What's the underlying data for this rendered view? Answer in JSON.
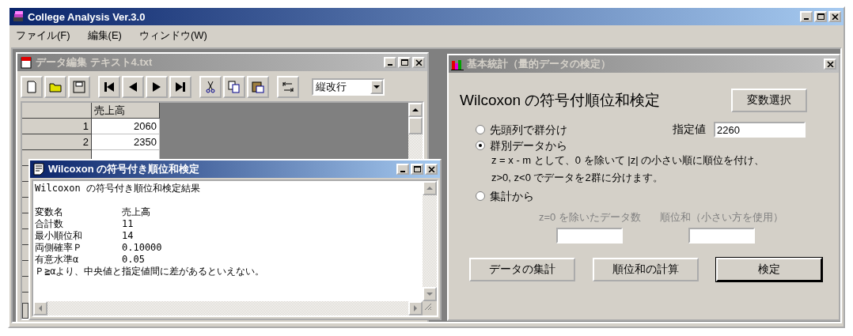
{
  "app": {
    "title": "College Analysis Ver.3.0",
    "active": true
  },
  "menu": [
    "ファイル(F)",
    "編集(E)",
    "ウィンドウ(W)"
  ],
  "data_window": {
    "title": "データ編集 テキスト4.txt",
    "active": false,
    "toolbar": [
      {
        "kind": "new"
      },
      {
        "kind": "open"
      },
      {
        "kind": "save"
      },
      {
        "kind": "first"
      },
      {
        "kind": "prev"
      },
      {
        "kind": "next"
      },
      {
        "kind": "last"
      },
      {
        "kind": "cut"
      },
      {
        "kind": "copy"
      },
      {
        "kind": "paste"
      },
      {
        "kind": "tab"
      }
    ],
    "mode_select": {
      "value": "縦改行"
    },
    "columns": [
      "売上高"
    ],
    "rows": [
      {
        "index": "1",
        "value": "2060"
      },
      {
        "index": "2",
        "value": "2350"
      }
    ]
  },
  "result_window": {
    "title": "Wilcoxon の符号付き順位和検定",
    "active": true,
    "heading": "Wilcoxon の符号付き順位和検定結果",
    "items": [
      {
        "label": "変数名",
        "value": "売上高"
      },
      {
        "label": "合計数",
        "value": "11"
      },
      {
        "label": "最小順位和",
        "value": "14"
      },
      {
        "label": "両側確率Ｐ",
        "value": "0.10000"
      },
      {
        "label": "有意水準α",
        "value": "0.05"
      }
    ],
    "conclusion": "Ｐ≧αより、中央値と指定値間に差があるといえない。"
  },
  "dialog": {
    "title": "基本統計（量的データの検定）",
    "active": false,
    "heading": "Wilcoxon の符号付順位和検定",
    "select_button": "変数選択",
    "options": [
      {
        "label": "先頭列で群分け",
        "selected": false
      },
      {
        "label": "群別データから",
        "selected": true
      },
      {
        "label": "集計から",
        "selected": false
      }
    ],
    "description": [
      "z = x - m として、0 を除いて |z| の小さい順に順位を付け、",
      "z>0, z<0 でデータを2群に分けます。"
    ],
    "target_label": "指定値",
    "target_value": "2260",
    "summary_fields": [
      {
        "label": "z=0 を除いたデータ数",
        "disabled": true
      },
      {
        "label": "順位和（小さい方を使用）",
        "disabled": true
      }
    ],
    "buttons": [
      {
        "label": "データの集計",
        "default": false
      },
      {
        "label": "順位和の計算",
        "default": false
      },
      {
        "label": "検定",
        "default": true
      }
    ]
  }
}
